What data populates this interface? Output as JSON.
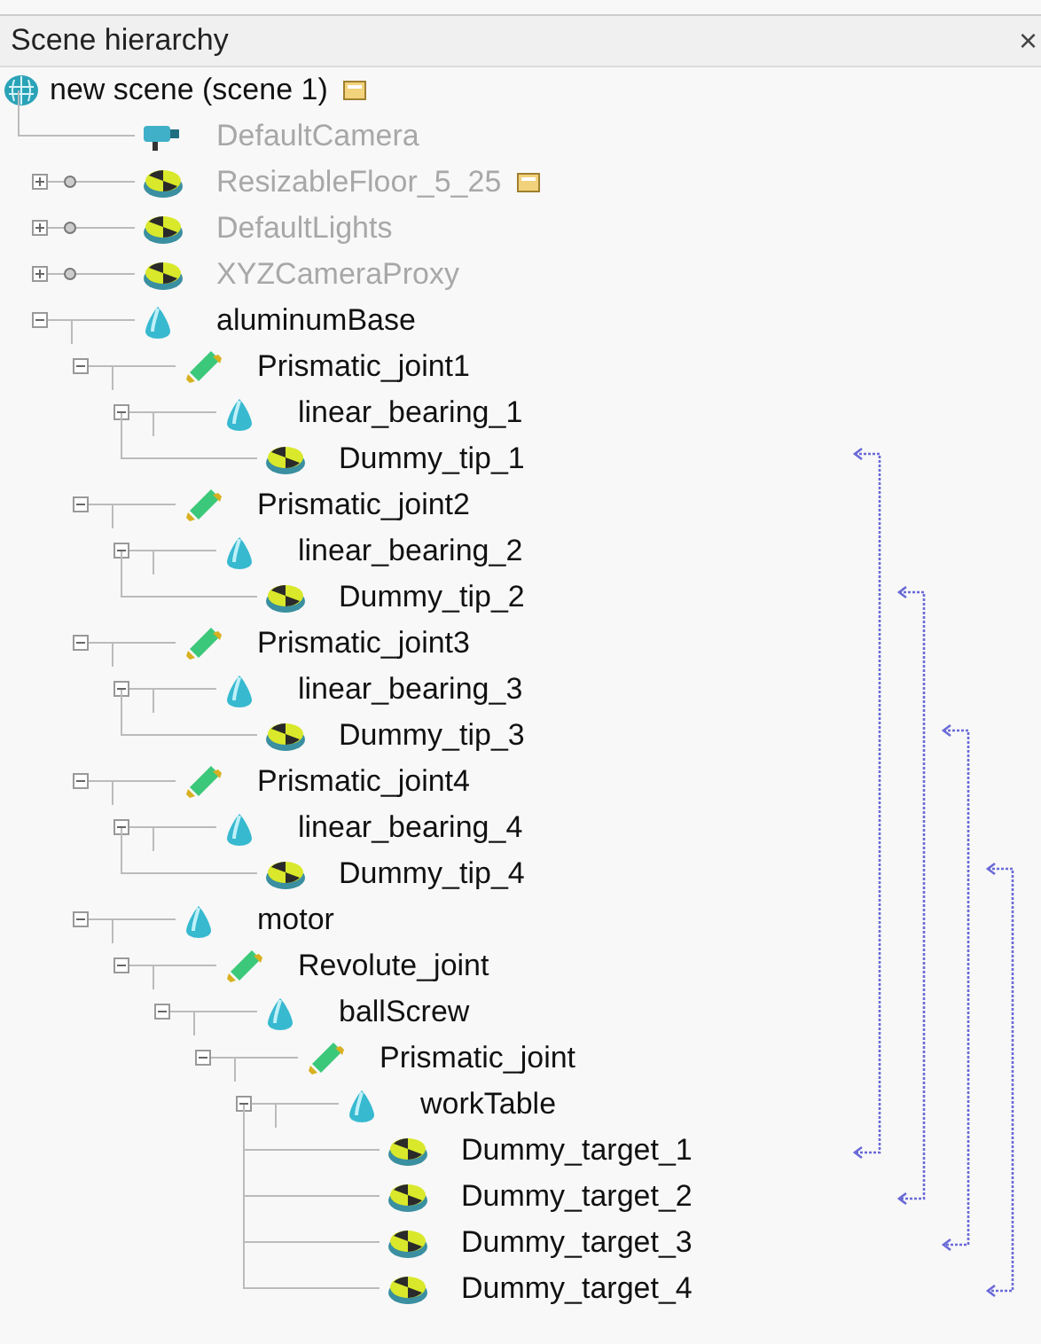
{
  "panel": {
    "title": "Scene hierarchy",
    "close": "×"
  },
  "tree": [
    {
      "label": "new scene (scene 1)",
      "kind": "scene",
      "extra_icon": true,
      "children": [
        {
          "label": "DefaultCamera",
          "kind": "camera",
          "dimmed": true
        },
        {
          "label": "ResizableFloor_5_25",
          "kind": "dummy",
          "dimmed": true,
          "model": true,
          "extra_icon": true,
          "expanded": false
        },
        {
          "label": "DefaultLights",
          "kind": "dummy",
          "dimmed": true,
          "model": true,
          "expanded": false
        },
        {
          "label": "XYZCameraProxy",
          "kind": "dummy",
          "dimmed": true,
          "model": true,
          "expanded": false
        },
        {
          "label": "aluminumBase",
          "kind": "shape",
          "dimmed": false,
          "expanded": true,
          "children": [
            {
              "label": "Prismatic_joint1",
              "kind": "joint",
              "dimmed": false,
              "expanded": true,
              "children": [
                {
                  "label": "linear_bearing_1",
                  "kind": "shape",
                  "dimmed": false,
                  "expanded": true,
                  "children": [
                    {
                      "label": "Dummy_tip_1",
                      "kind": "dummy",
                      "dimmed": false,
                      "link_source": true
                    }
                  ]
                }
              ]
            },
            {
              "label": "Prismatic_joint2",
              "kind": "joint",
              "dimmed": false,
              "expanded": true,
              "children": [
                {
                  "label": "linear_bearing_2",
                  "kind": "shape",
                  "dimmed": false,
                  "expanded": true,
                  "children": [
                    {
                      "label": "Dummy_tip_2",
                      "kind": "dummy",
                      "dimmed": false,
                      "link_source": true
                    }
                  ]
                }
              ]
            },
            {
              "label": "Prismatic_joint3",
              "kind": "joint",
              "dimmed": false,
              "expanded": true,
              "children": [
                {
                  "label": "linear_bearing_3",
                  "kind": "shape",
                  "dimmed": false,
                  "expanded": true,
                  "children": [
                    {
                      "label": "Dummy_tip_3",
                      "kind": "dummy",
                      "dimmed": false,
                      "link_source": true
                    }
                  ]
                }
              ]
            },
            {
              "label": "Prismatic_joint4",
              "kind": "joint",
              "dimmed": false,
              "expanded": true,
              "children": [
                {
                  "label": "linear_bearing_4",
                  "kind": "shape",
                  "dimmed": false,
                  "expanded": true,
                  "children": [
                    {
                      "label": "Dummy_tip_4",
                      "kind": "dummy",
                      "dimmed": false,
                      "link_source": true
                    }
                  ]
                }
              ]
            },
            {
              "label": "motor",
              "kind": "shape",
              "dimmed": false,
              "expanded": true,
              "children": [
                {
                  "label": "Revolute_joint",
                  "kind": "joint",
                  "dimmed": false,
                  "expanded": true,
                  "children": [
                    {
                      "label": "ballScrew",
                      "kind": "shape",
                      "dimmed": false,
                      "expanded": true,
                      "children": [
                        {
                          "label": "Prismatic_joint",
                          "kind": "joint",
                          "dimmed": false,
                          "expanded": true,
                          "children": [
                            {
                              "label": "workTable",
                              "kind": "shape",
                              "dimmed": false,
                              "expanded": true,
                              "children": [
                                {
                                  "label": "Dummy_target_1",
                                  "kind": "dummy",
                                  "dimmed": false,
                                  "link_target": true
                                },
                                {
                                  "label": "Dummy_target_2",
                                  "kind": "dummy",
                                  "dimmed": false,
                                  "link_target": true
                                },
                                {
                                  "label": "Dummy_target_3",
                                  "kind": "dummy",
                                  "dimmed": false,
                                  "link_target": true
                                },
                                {
                                  "label": "Dummy_target_4",
                                  "kind": "dummy",
                                  "dimmed": false,
                                  "link_target": true
                                }
                              ]
                            }
                          ]
                        }
                      ]
                    }
                  ]
                }
              ]
            }
          ]
        }
      ]
    }
  ]
}
